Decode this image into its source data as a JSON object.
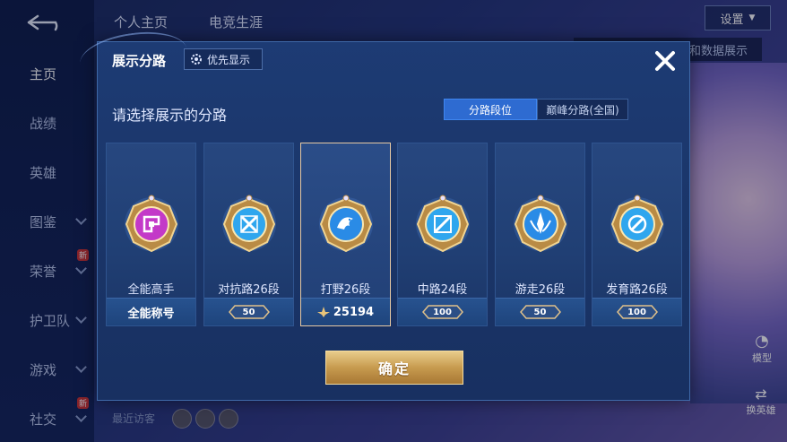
{
  "background": {
    "top_tabs": [
      "个人主页",
      "电竞生涯"
    ],
    "settings_label": "设置",
    "tip_text": "在主页和数据展示",
    "sidebar_items": [
      {
        "label": "主页",
        "active": true,
        "chevron": false,
        "new": false
      },
      {
        "label": "战绩",
        "active": false,
        "chevron": false,
        "new": false
      },
      {
        "label": "英雄",
        "active": false,
        "chevron": false,
        "new": false
      },
      {
        "label": "图鉴",
        "active": false,
        "chevron": true,
        "new": false
      },
      {
        "label": "荣誉",
        "active": false,
        "chevron": true,
        "new": true
      },
      {
        "label": "护卫队",
        "active": false,
        "chevron": true,
        "new": false
      },
      {
        "label": "游戏",
        "active": false,
        "chevron": true,
        "new": false
      },
      {
        "label": "社交",
        "active": false,
        "chevron": true,
        "new": true
      }
    ],
    "new_badge": "新",
    "model_label": "模型",
    "swap_hero_label": "换英雄",
    "recent_visitors_label": "最近访客"
  },
  "modal": {
    "title": "展示分路",
    "priority_label": "优先显示",
    "subtitle": "请选择展示的分路",
    "segments": [
      {
        "label": "分路段位",
        "active": true
      },
      {
        "label": "巅峰分路(全国)",
        "active": false
      }
    ],
    "cards": [
      {
        "label": "全能高手",
        "footer_type": "text",
        "footer_text": "全能称号",
        "icon": "allround-badge-icon",
        "accent": "#c339c8",
        "selected": false
      },
      {
        "label": "对抗路26段",
        "footer_type": "pill",
        "footer_text": "50",
        "icon": "clash-lane-badge-icon",
        "accent": "#2fa6ee",
        "selected": false
      },
      {
        "label": "打野26段",
        "footer_type": "score",
        "footer_text": "25194",
        "icon": "jungle-badge-icon",
        "accent": "#2a8be6",
        "selected": true
      },
      {
        "label": "中路24段",
        "footer_type": "pill",
        "footer_text": "100",
        "icon": "mid-lane-badge-icon",
        "accent": "#2fa6ee",
        "selected": false
      },
      {
        "label": "游走26段",
        "footer_type": "pill",
        "footer_text": "50",
        "icon": "roam-badge-icon",
        "accent": "#2a8be6",
        "selected": false
      },
      {
        "label": "发育路26段",
        "footer_type": "pill",
        "footer_text": "100",
        "icon": "farm-lane-badge-icon",
        "accent": "#2fa6ee",
        "selected": false
      }
    ],
    "confirm_label": "确定"
  }
}
